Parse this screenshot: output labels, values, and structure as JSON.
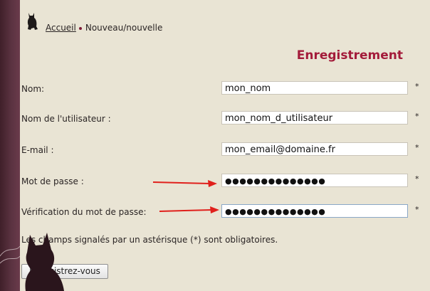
{
  "breadcrumb": {
    "home_label": "Accueil",
    "current_label": "Nouveau/nouvelle"
  },
  "page": {
    "title": "Enregistrement"
  },
  "form": {
    "name": {
      "label": "Nom:",
      "value": "mon_nom",
      "required_marker": "*"
    },
    "username": {
      "label": "Nom de l'utilisateur :",
      "value": "mon_nom_d_utilisateur",
      "required_marker": "*"
    },
    "email": {
      "label": "E-mail :",
      "value": "mon_email@domaine.fr",
      "required_marker": "*"
    },
    "password": {
      "label": "Mot de passe :",
      "value": "●●●●●●●●●●●●●●",
      "required_marker": "*"
    },
    "password_confirm": {
      "label": "Vérification du mot de passe:",
      "value": "●●●●●●●●●●●●●●",
      "required_marker": "*"
    },
    "required_note": "Les champs signalés par un astérisque (*) sont obligatoires.",
    "submit_label": "Enregistrez-vous"
  },
  "colors": {
    "title": "#a31b3a",
    "arrow": "#e0201c",
    "sidebar": "#5a3240",
    "background": "#e9e4d4"
  },
  "icons": [
    "cat-icon",
    "arrow-icon",
    "cat-silhouette-icon"
  ]
}
